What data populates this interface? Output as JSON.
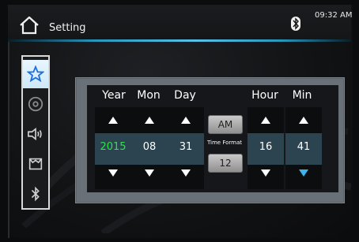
{
  "header": {
    "title": "Setting",
    "time": "09:32 AM"
  },
  "sidebar": {
    "items": [
      {
        "icon": "star-icon"
      },
      {
        "icon": "disc-icon"
      },
      {
        "icon": "volume-icon"
      },
      {
        "icon": "car-icon"
      },
      {
        "icon": "bluetooth-icon"
      }
    ]
  },
  "datetime": {
    "headers": {
      "year": "Year",
      "mon": "Mon",
      "day": "Day",
      "hour": "Hour",
      "min": "Min"
    },
    "values": {
      "year": "2015",
      "mon": "08",
      "day": "31",
      "hour": "16",
      "min": "41"
    },
    "time_format_label": "Time Format",
    "am_label": "AM",
    "format_value": "12"
  },
  "colors": {
    "accent": "#3cb4ec",
    "year_value": "#2fe04d"
  }
}
